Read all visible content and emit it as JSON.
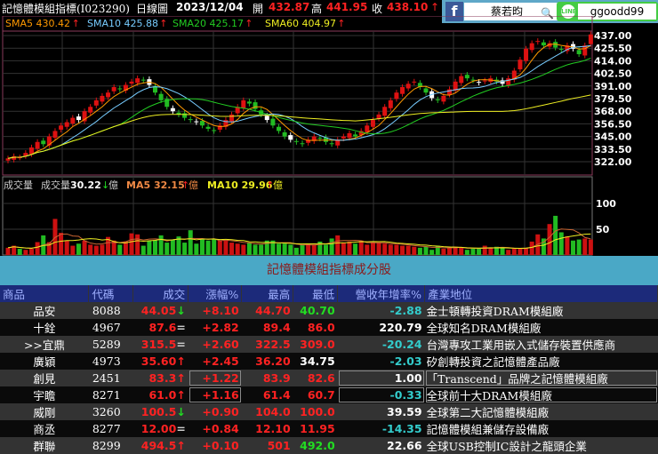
{
  "header": {
    "title": "記憶體模組指標(I023290)",
    "chart_type": "日線圖",
    "date": "2023/12/04",
    "open_label": "開",
    "open": "432.87",
    "high_label": "高",
    "high": "441.95",
    "close_label": "收",
    "close": "438.10",
    "arrow": "↑"
  },
  "social": {
    "facebook_name": "蔡若昀",
    "line_id": "ggoodd99",
    "line_icon": "LINE"
  },
  "ma_legend": [
    {
      "label": "SMA5 430.42",
      "color": "#f90"
    },
    {
      "label": "SMA10 425.88",
      "color": "#7cf"
    },
    {
      "label": "SMA20 425.17",
      "color": "#2c2"
    },
    {
      "label": "SMA60 404.97",
      "color": "#ee2"
    }
  ],
  "volume_legend": {
    "title": "成交量",
    "vol_label": "成交量",
    "vol": "30.22",
    "vol_unit": "億",
    "ma5": "MA5 32.15",
    "ma10": "MA10 29.96"
  },
  "chart_data": {
    "type": "candlestick",
    "price_ticks": [
      "437.00",
      "425.50",
      "414.00",
      "402.50",
      "391.00",
      "379.50",
      "368.00",
      "356.50",
      "345.00",
      "333.50",
      "322.00"
    ],
    "price_range": [
      322,
      437
    ],
    "volume_ticks": [
      "100",
      "50"
    ],
    "closes": [
      325,
      327,
      326,
      330,
      335,
      340,
      338,
      345,
      350,
      355,
      358,
      362,
      360,
      368,
      372,
      378,
      382,
      385,
      390,
      388,
      392,
      395,
      398,
      396,
      392,
      385,
      378,
      372,
      368,
      365,
      362,
      360,
      358,
      355,
      352,
      350,
      355,
      360,
      365,
      372,
      378,
      375,
      370,
      365,
      360,
      355,
      350,
      345,
      342,
      340,
      338,
      342,
      345,
      343,
      340,
      338,
      342,
      345,
      348,
      345,
      350,
      355,
      360,
      365,
      372,
      378,
      385,
      390,
      393,
      395,
      390,
      385,
      380,
      378,
      382,
      388,
      395,
      400,
      398,
      396,
      394,
      396,
      398,
      395,
      393,
      398,
      405,
      415,
      425,
      430,
      432,
      428,
      430,
      426,
      424,
      428,
      425,
      420,
      428,
      438
    ],
    "volumes": [
      14,
      18,
      12,
      10,
      12,
      25,
      38,
      25,
      70,
      43,
      28,
      18,
      22,
      28,
      20,
      18,
      20,
      35,
      28,
      20,
      26,
      42,
      40,
      18,
      28,
      28,
      38,
      24,
      30,
      36,
      24,
      48,
      22,
      30,
      28,
      30,
      28,
      28,
      24,
      22,
      20,
      24,
      20,
      20,
      28,
      28,
      22,
      22,
      20,
      14,
      20,
      22,
      20,
      26,
      20,
      32,
      38,
      24,
      26,
      22,
      28,
      20,
      24,
      24,
      22,
      20,
      20,
      18,
      18,
      16,
      14,
      16,
      10,
      18,
      12,
      14,
      16,
      14,
      10,
      12,
      12,
      18,
      14,
      16,
      14,
      10,
      12,
      12,
      14,
      26,
      40,
      32,
      60,
      76,
      44,
      36,
      28,
      30,
      32,
      30
    ]
  },
  "section_title": "記憶體模組指標成分股",
  "table": {
    "headers": [
      "商品",
      "代碼",
      "成交",
      "漲幅%",
      "最高",
      "最低",
      "營收年增率%",
      "產業地位"
    ],
    "rows": [
      {
        "name": "品安",
        "code": "8088",
        "price": "44.05",
        "arrow": "↓",
        "chg": "+8.10",
        "high": "44.70",
        "low": "40.70",
        "low_color": "#2d2",
        "rev": "-2.88",
        "ind": "金士頓轉投資DRAM模組廠"
      },
      {
        "name": "十銓",
        "code": "4967",
        "price": "87.6",
        "arrow": "=",
        "chg": "+2.82",
        "high": "89.4",
        "low": "86.0",
        "low_color": "#f22",
        "rev": "220.79",
        "ind": "全球知名DRAM模組廠"
      },
      {
        "name": ">>宜鼎",
        "code": "5289",
        "price": "315.5",
        "arrow": "=",
        "chg": "+2.60",
        "high": "322.5",
        "low": "309.0",
        "low_color": "#f22",
        "rev": "-20.24",
        "ind": "台灣專攻工業用嵌入式儲存裝置供應商"
      },
      {
        "name": "廣穎",
        "code": "4973",
        "price": "35.60",
        "arrow": "↑",
        "chg": "+2.45",
        "high": "36.20",
        "low": "34.75",
        "low_color": "#fff",
        "rev": "-2.03",
        "ind": "矽創轉投資之記憶體產品廠"
      },
      {
        "name": "創見",
        "code": "2451",
        "price": "83.3",
        "arrow": "↑",
        "chg": "+1.22",
        "high": "83.9",
        "low": "82.6",
        "low_color": "#f22",
        "rev": "1.00",
        "ind": "「Transcend」品牌之記憶體模組廠"
      },
      {
        "name": "宇瞻",
        "code": "8271",
        "price": "61.0",
        "arrow": "↑",
        "chg": "+1.16",
        "high": "61.4",
        "low": "60.7",
        "low_color": "#f22",
        "rev": "-0.33",
        "ind": "全球前十大DRAM模組廠"
      },
      {
        "name": "威剛",
        "code": "3260",
        "price": "100.5",
        "arrow": "↓",
        "chg": "+0.90",
        "high": "104.0",
        "low": "100.0",
        "low_color": "#f22",
        "rev": "39.59",
        "ind": "全球第二大記憶體模組廠"
      },
      {
        "name": "商丞",
        "code": "8277",
        "price": "12.00",
        "arrow": "=",
        "chg": "+0.84",
        "high": "12.10",
        "low": "11.95",
        "low_color": "#f22",
        "rev": "-14.35",
        "ind": "記憶體模組兼儲存設備廠"
      },
      {
        "name": "群聯",
        "code": "8299",
        "price": "494.5",
        "arrow": "↑",
        "chg": "+0.10",
        "high": "501",
        "low": "492.0",
        "low_color": "#2d2",
        "rev": "22.66",
        "ind": "全球USB控制IC設計之龍頭企業"
      }
    ]
  }
}
